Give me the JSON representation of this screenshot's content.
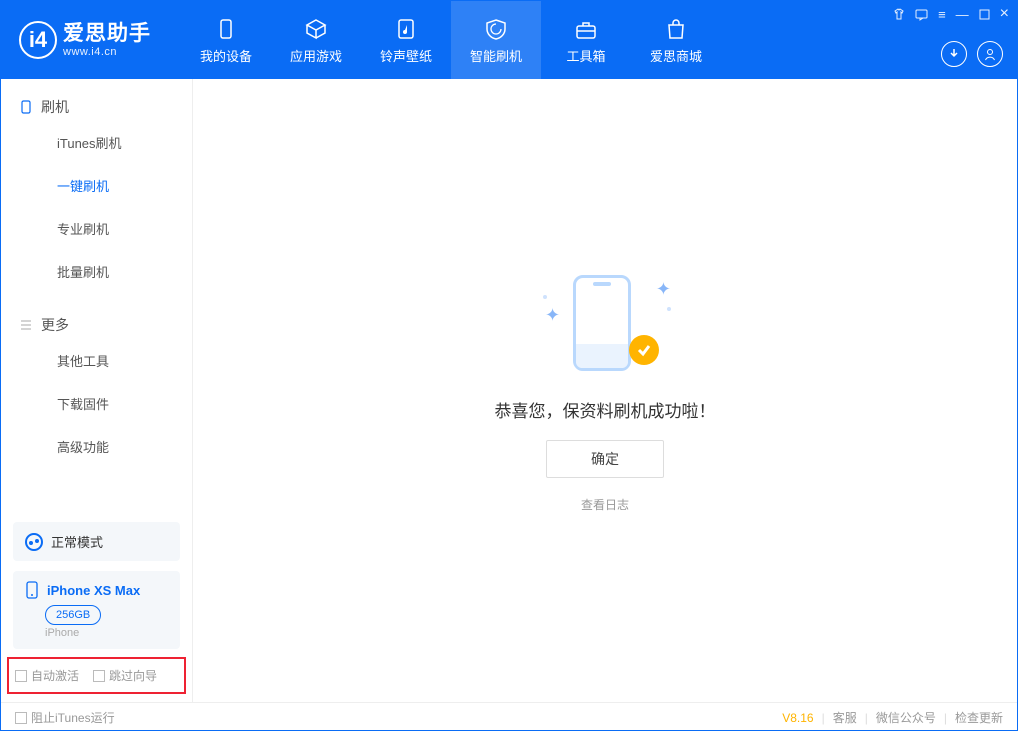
{
  "app": {
    "name": "爱思助手",
    "url": "www.i4.cn"
  },
  "tabs": [
    {
      "label": "我的设备"
    },
    {
      "label": "应用游戏"
    },
    {
      "label": "铃声壁纸"
    },
    {
      "label": "智能刷机"
    },
    {
      "label": "工具箱"
    },
    {
      "label": "爱思商城"
    }
  ],
  "sidebar": {
    "group1": {
      "title": "刷机",
      "items": [
        "iTunes刷机",
        "一键刷机",
        "专业刷机",
        "批量刷机"
      ]
    },
    "group2": {
      "title": "更多",
      "items": [
        "其他工具",
        "下载固件",
        "高级功能"
      ]
    },
    "mode": "正常模式",
    "device": {
      "name": "iPhone XS Max",
      "storage": "256GB",
      "type": "iPhone"
    },
    "checks": {
      "auto_activate": "自动激活",
      "skip_guide": "跳过向导"
    }
  },
  "main": {
    "success": "恭喜您，保资料刷机成功啦！",
    "ok": "确定",
    "view_log": "查看日志"
  },
  "footer": {
    "block_itunes": "阻止iTunes运行",
    "version": "V8.16",
    "support": "客服",
    "wechat": "微信公众号",
    "update": "检查更新"
  }
}
